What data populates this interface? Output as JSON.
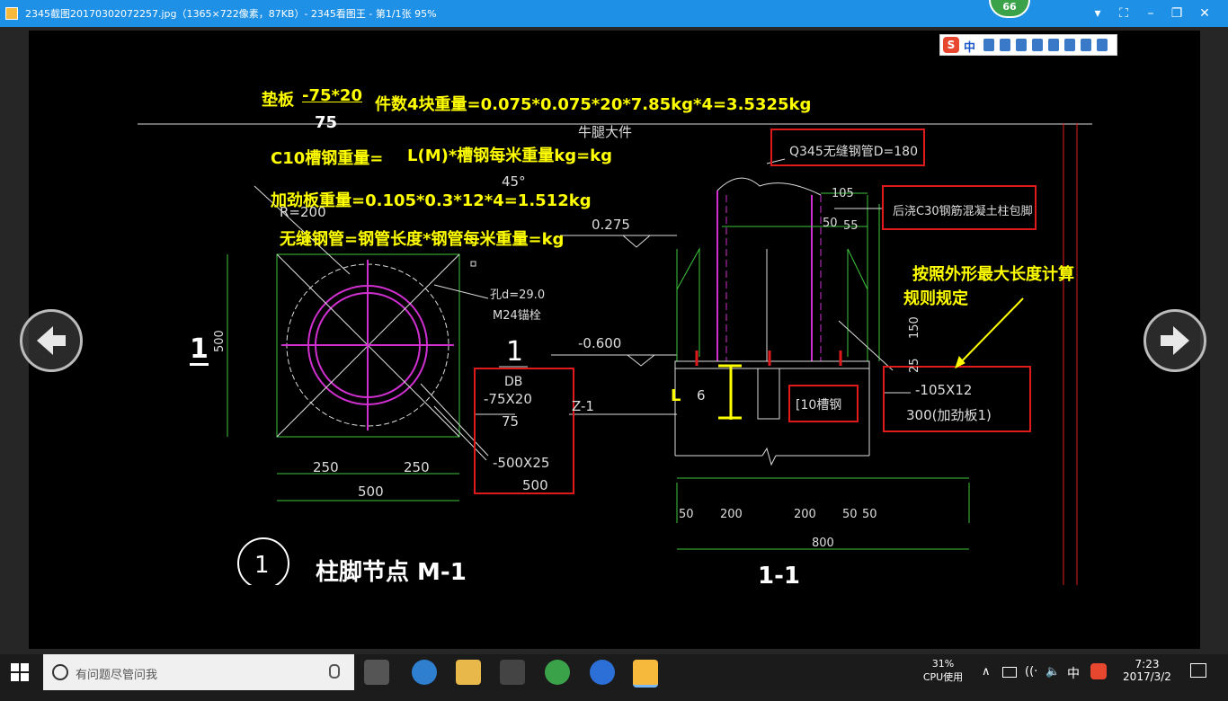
{
  "window": {
    "title": "2345截图20170302072257.jpg（1365×722像素，87KB）- 2345看图王 - 第1/1张 95%",
    "badge": "66"
  },
  "ime": {
    "brand": "S",
    "mode": "中"
  },
  "annotations": {
    "pad_label": "垫板",
    "pad_fraction_top": "-75*20",
    "pad_fraction_bottom": "75",
    "pad_weight": "件数4块重量=0.075*0.075*20*7.85kg*4=3.5325kg",
    "channel_label": "C10槽钢重量=",
    "channel_formula": "L(M)*槽钢每米重量kg=kg",
    "stiffener": "加劲板重量=0.105*0.3*12*4=1.512kg",
    "pipe": "无缝钢管=钢管长度*钢管每米重量=kg",
    "rule_line1": "按照外形最大长度计算",
    "rule_line2": "规则规定",
    "L_mark": "L"
  },
  "drawing": {
    "top_partial": "牛腿大件",
    "r200": "R=200",
    "angle": "45°",
    "elev_top": "0.275",
    "hole": "孔d=29.0",
    "anchor": "M24锚栓",
    "section_1": "1",
    "db_label": "DB",
    "db_plate": "-75X20",
    "db_75": "75",
    "base_plate": "-500X25",
    "base_500": "500",
    "z1": "Z-1",
    "elev_neg": "-0.600",
    "dim_500_v": "500",
    "dim_250a": "250",
    "dim_250b": "250",
    "dim_500_h": "500",
    "pipe_spec": "Q345无缝钢管D=180",
    "concrete": "后浇C30钢筋混凝土柱包脚",
    "d105": "105",
    "d50": "50",
    "d55": "55",
    "d150": "150",
    "d25": "25",
    "d6": "6",
    "channel_box": "[10槽钢",
    "stiff_spec": "-105X12",
    "stiff_name": "300(加劲板1)",
    "b50a": "50",
    "b200a": "200",
    "b200b": "200",
    "b50b": "50",
    "b50c": "50",
    "b800": "800",
    "circle_no": "1",
    "node_title": "柱脚节点 M-1",
    "section_title": "1-1"
  },
  "taskbar": {
    "search_placeholder": "有问题尽管问我",
    "cpu_percent": "31%",
    "cpu_label": "CPU使用",
    "ime_tray": "中",
    "time": "7:23",
    "date": "2017/3/2"
  },
  "colors": {
    "titlebar": "#1e90e6",
    "annotation": "#ffff00",
    "cad_red": "#e01a1a",
    "cad_green": "#3cc73c",
    "cad_magenta": "#d030d0"
  }
}
